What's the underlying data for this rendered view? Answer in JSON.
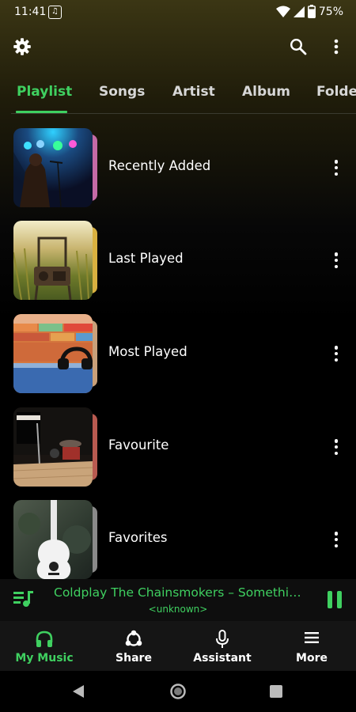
{
  "status_bar": {
    "time": "11:41",
    "battery": "75%"
  },
  "tabs": [
    {
      "label": "Playlist",
      "active": true
    },
    {
      "label": "Songs"
    },
    {
      "label": "Artist"
    },
    {
      "label": "Album"
    },
    {
      "label": "Folder"
    }
  ],
  "playlists": [
    {
      "label": "Recently Added"
    },
    {
      "label": "Last Played"
    },
    {
      "label": "Most Played"
    },
    {
      "label": "Favourite"
    },
    {
      "label": "Favorites"
    }
  ],
  "mini_player": {
    "title": "Coldplay The Chainsmokers – Something Just Like This",
    "subtitle": "<unknown>"
  },
  "bottom_nav": [
    {
      "label": "My Music",
      "icon": "headphones-icon",
      "active": true
    },
    {
      "label": "Share",
      "icon": "share-icon"
    },
    {
      "label": "Assistant",
      "icon": "mic-icon"
    },
    {
      "label": "More",
      "icon": "menu-icon"
    }
  ],
  "colors": {
    "accent": "#3fd060",
    "background": "#000000"
  }
}
